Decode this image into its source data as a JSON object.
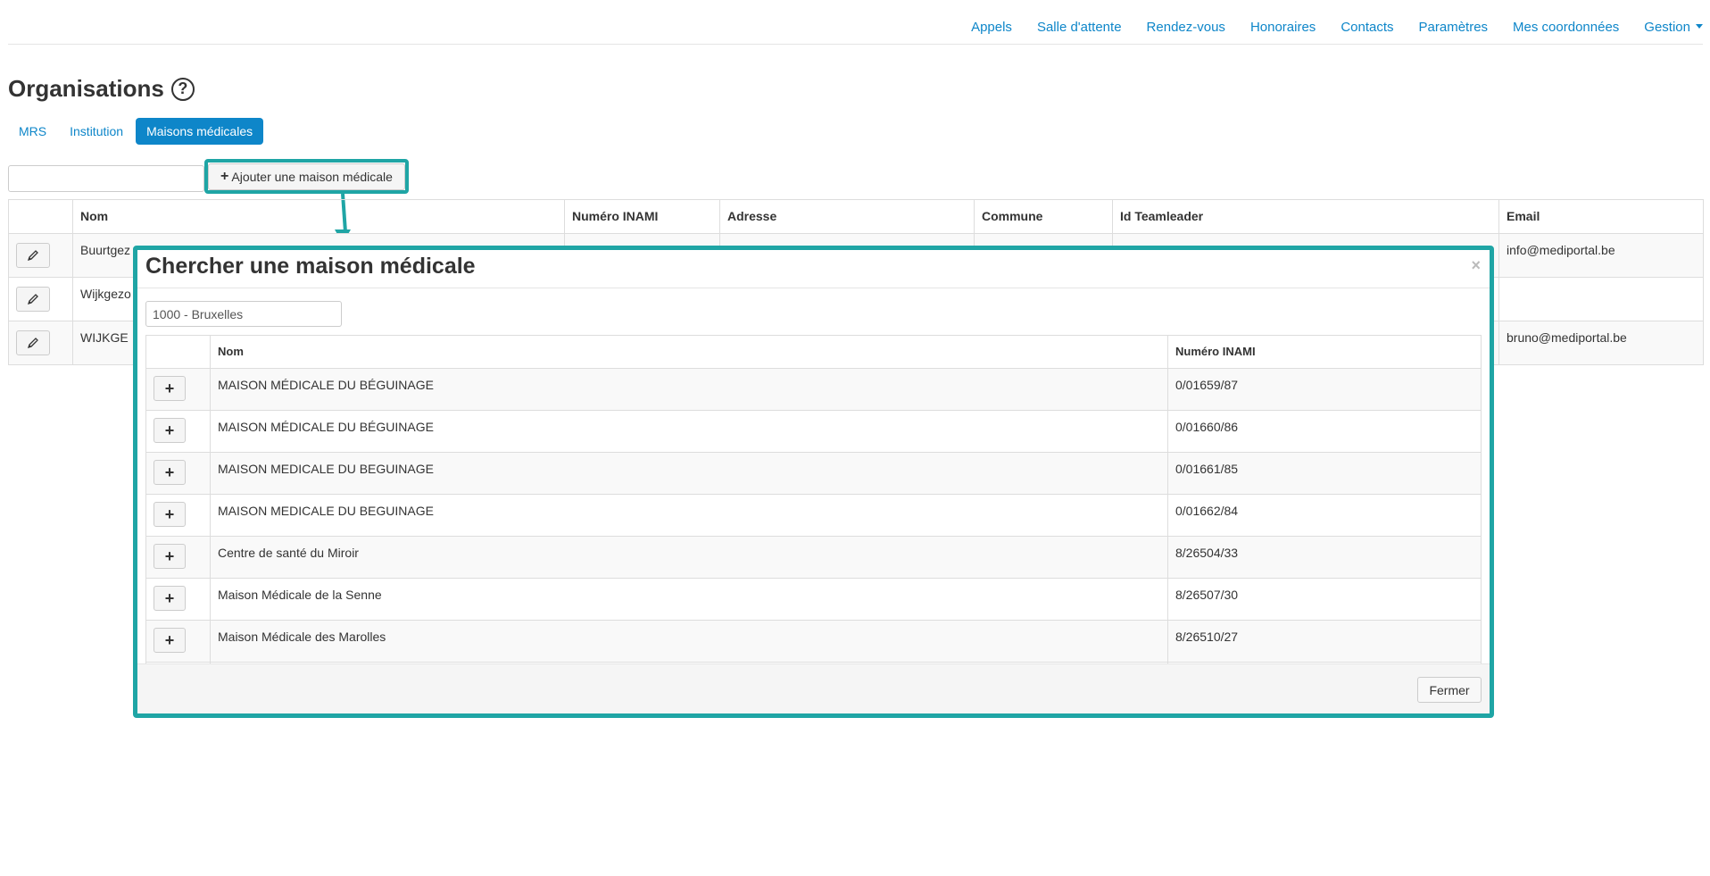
{
  "nav": {
    "items": [
      "Appels",
      "Salle d'attente",
      "Rendez-vous",
      "Honoraires",
      "Contacts",
      "Paramètres",
      "Mes coordonnées"
    ],
    "gestion": "Gestion"
  },
  "page": {
    "title": "Organisations",
    "help_icon": "question-circle-icon"
  },
  "tabs": [
    {
      "label": "MRS",
      "active": false
    },
    {
      "label": "Institution",
      "active": false
    },
    {
      "label": "Maisons médicales",
      "active": true
    }
  ],
  "search": {
    "value": ""
  },
  "add_button": {
    "label": "Ajouter une maison médicale"
  },
  "colors": {
    "accent": "#0e86c9",
    "highlight": "#1fa5a5"
  },
  "main_table": {
    "headers": [
      "",
      "Nom",
      "Numéro INAMI",
      "Adresse",
      "Commune",
      "Id Teamleader",
      "Email"
    ],
    "rows": [
      {
        "nom": "Buurtgez",
        "email": "info@mediportal.be"
      },
      {
        "nom": "Wijkgezo",
        "email": ""
      },
      {
        "nom": "WIJKGE",
        "email": "bruno@mediportal.be"
      }
    ]
  },
  "modal": {
    "title": "Chercher une maison médicale",
    "close": "×",
    "search_value": "1000 - Bruxelles",
    "headers": [
      "",
      "Nom",
      "Numéro INAMI"
    ],
    "rows": [
      {
        "nom": "MAISON MÉDICALE DU BÉGUINAGE",
        "inami": "0/01659/87"
      },
      {
        "nom": "MAISON MÉDICALE DU BÉGUINAGE",
        "inami": "0/01660/86"
      },
      {
        "nom": "MAISON MEDICALE DU BEGUINAGE",
        "inami": "0/01661/85"
      },
      {
        "nom": "MAISON MEDICALE DU BEGUINAGE",
        "inami": "0/01662/84"
      },
      {
        "nom": "Centre de santé du Miroir",
        "inami": "8/26504/33"
      },
      {
        "nom": "Maison Médicale de la Senne",
        "inami": "8/26507/30"
      },
      {
        "nom": "Maison Médicale des Marolles",
        "inami": "8/26510/27"
      }
    ],
    "footer_button": "Fermer"
  }
}
